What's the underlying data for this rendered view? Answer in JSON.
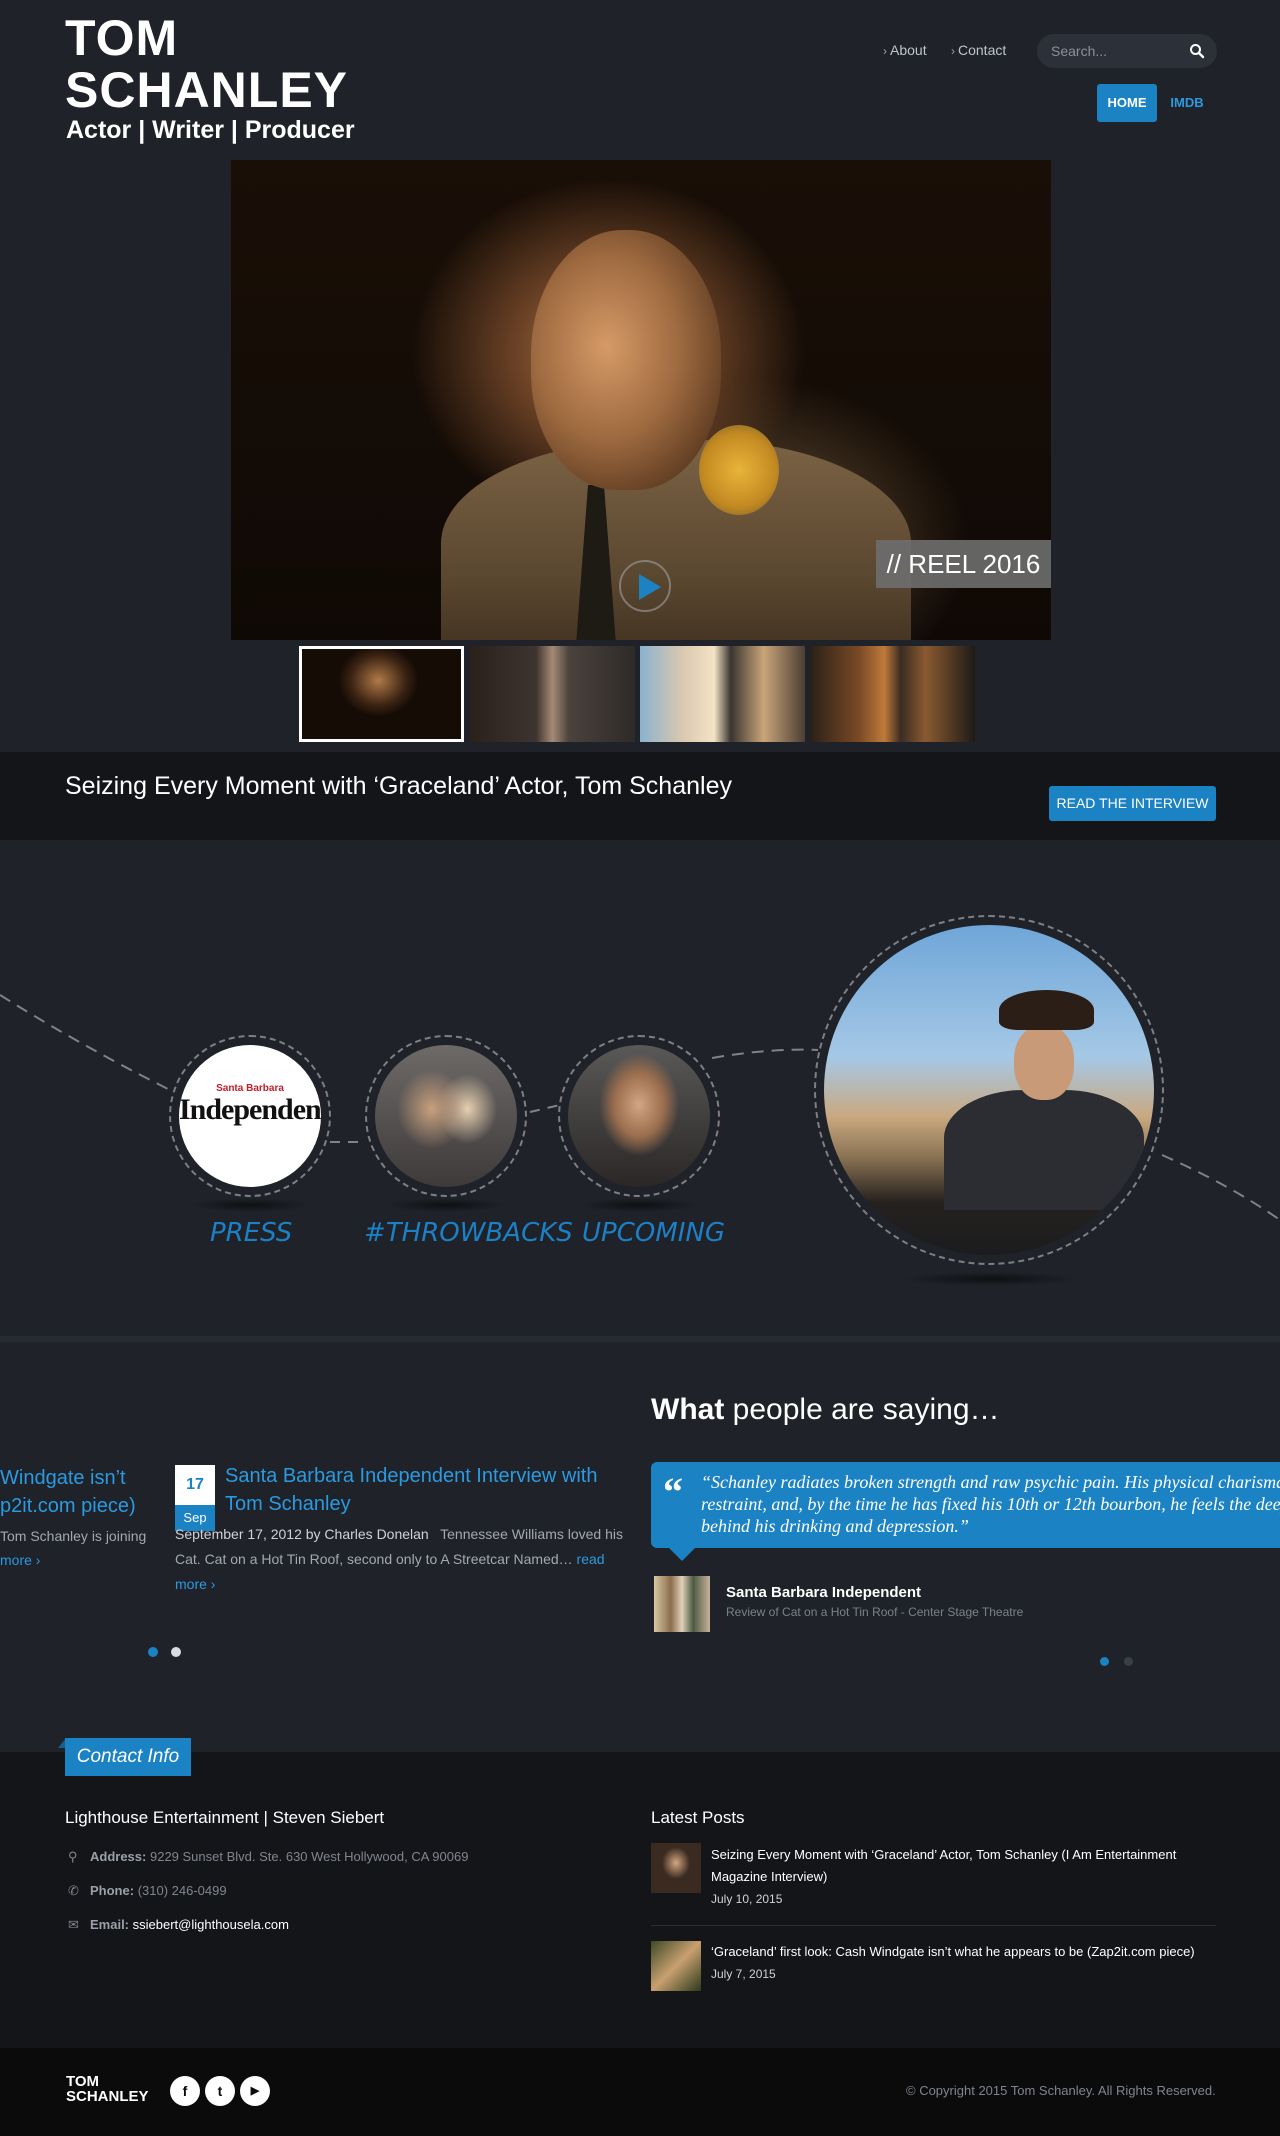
{
  "header": {
    "logo_line1": "TOM",
    "logo_line2": "SCHANLEY",
    "tagline": "Actor | Writer | Producer",
    "links": [
      {
        "label": "About"
      },
      {
        "label": "Contact"
      }
    ],
    "search_placeholder": "Search...",
    "nav": [
      {
        "label": "HOME",
        "active": true
      },
      {
        "label": "IMDB",
        "active": false
      }
    ]
  },
  "hero": {
    "caption": "// REEL 2016",
    "thumbnails": [
      "thumb-1",
      "thumb-2",
      "thumb-3",
      "thumb-4"
    ],
    "active_thumbnail": 0
  },
  "interview": {
    "title": "Seizing Every Moment with ‘Graceland’ Actor, Tom Schanley",
    "button": "READ THE INTERVIEW"
  },
  "categories": {
    "items": [
      {
        "label": "PRESS",
        "logo_top": "Santa Barbara",
        "logo_main": "Independent"
      },
      {
        "label": "#THROWBACKS"
      },
      {
        "label": "UPCOMING"
      }
    ]
  },
  "posts": {
    "prev": {
      "title_line1": "Windgate isn’t",
      "title_line2": "p2it.com piece)",
      "excerpt": "Tom Schanley is joining",
      "read_more": "more"
    },
    "current": {
      "day": "17",
      "month": "Sep",
      "title": "Santa Barbara Independent Interview with Tom Schanley",
      "meta": "September 17, 2012 by Charles Donelan",
      "excerpt": "Tennessee Williams loved his Cat. Cat on a Hot Tin Roof, second only to A Streetcar Named…",
      "read_more": "read more"
    },
    "dots": 2,
    "active_dot": 0
  },
  "testimonials": {
    "title_bold": "What",
    "title_rest": "people are saying…",
    "quote": "“Schanley radiates broken strength and raw psychic pain. His physical charisma, athleticism and restraint, and, by the time he has fixed his 10th or 12th bourbon, he feels the deep compulsion behind his drinking and depression.”",
    "reviewer": "Santa Barbara Independent",
    "review_of": "Review of Cat on a Hot Tin Roof - Center Stage Theatre",
    "dots": 2,
    "active_dot": 0
  },
  "contact": {
    "tab": "Contact Info",
    "title": "Lighthouse Entertainment | Steven Siebert",
    "address_label": "Address:",
    "address": "9229 Sunset Blvd. Ste. 630 West Hollywood, CA 90069",
    "phone_label": "Phone:",
    "phone": "(310) 246-0499",
    "email_label": "Email:",
    "email": "ssiebert@lighthousela.com"
  },
  "latest_posts": {
    "title": "Latest Posts",
    "items": [
      {
        "title": "Seizing Every Moment with ‘Graceland’ Actor, Tom Schanley (I Am Entertainment Magazine Interview)",
        "date": "July 10, 2015"
      },
      {
        "title": "‘Graceland’ first look: Cash Windgate isn’t what he appears to be (Zap2it.com piece)",
        "date": "July 7, 2015"
      }
    ]
  },
  "footer": {
    "logo_line1": "TOM",
    "logo_line2": "SCHANLEY",
    "social": [
      "facebook-icon",
      "twitter-icon",
      "youtube-icon"
    ],
    "social_glyphs": [
      "f",
      "t",
      "▶"
    ],
    "copyright": "© Copyright 2015 Tom Schanley. All Rights Reserved."
  },
  "colors": {
    "accent": "#1b82c4",
    "background": "#1f2229",
    "dark_band": "#141518",
    "footer": "#0b0b0c"
  }
}
